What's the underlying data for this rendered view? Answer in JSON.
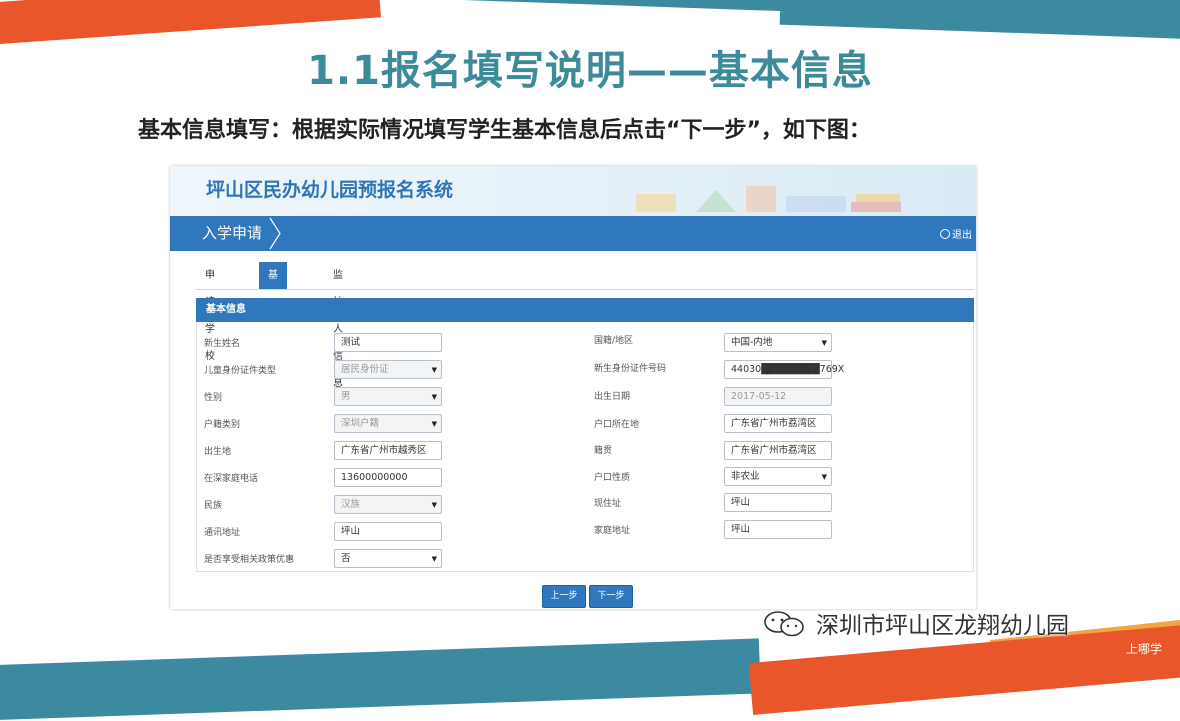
{
  "slide": {
    "title": "1.1报名填写说明——基本信息",
    "subtitle": "基本信息填写：根据实际情况填写学生基本信息后点击“下一步”，如下图："
  },
  "app": {
    "system_title": "坪山区民办幼儿园预报名系统",
    "nav_tab": "入学申请",
    "logout_label": "退出",
    "tabs": [
      {
        "label": "申请学校",
        "active": false
      },
      {
        "label": "基本信息",
        "active": true
      },
      {
        "label": "监护人信息",
        "active": false
      }
    ],
    "section_title": "基本信息",
    "left_fields": [
      {
        "label": "新生姓名",
        "value": "测试",
        "type": "input",
        "disabled": false
      },
      {
        "label": "儿童身份证件类型",
        "value": "居民身份证",
        "type": "select",
        "disabled": true
      },
      {
        "label": "性别",
        "value": "男",
        "type": "select",
        "disabled": true
      },
      {
        "label": "户籍类别",
        "value": "深圳户籍",
        "type": "select",
        "disabled": true
      },
      {
        "label": "出生地",
        "value": "广东省广州市越秀区",
        "type": "input",
        "disabled": false
      },
      {
        "label": "在深家庭电话",
        "value": "13600000000",
        "type": "input",
        "disabled": false
      },
      {
        "label": "民族",
        "value": "汉族",
        "type": "select",
        "disabled": true
      },
      {
        "label": "通讯地址",
        "value": "坪山",
        "type": "input",
        "disabled": false
      },
      {
        "label": "是否享受相关政策优惠",
        "value": "否",
        "type": "select",
        "disabled": false
      }
    ],
    "right_fields": [
      {
        "label": "国籍/地区",
        "value": "中国-内地",
        "type": "select",
        "disabled": false
      },
      {
        "label": "新生身份证件号码",
        "value": "44030████████769X",
        "type": "input",
        "disabled": false
      },
      {
        "label": "出生日期",
        "value": "2017-05-12",
        "type": "input",
        "disabled": true
      },
      {
        "label": "户口所在地",
        "value": "广东省广州市荔湾区",
        "type": "input",
        "disabled": false
      },
      {
        "label": "籍贯",
        "value": "广东省广州市荔湾区",
        "type": "input",
        "disabled": false
      },
      {
        "label": "户口性质",
        "value": "非农业",
        "type": "select",
        "disabled": false
      },
      {
        "label": "现住址",
        "value": "坪山",
        "type": "input",
        "disabled": false
      },
      {
        "label": "家庭地址",
        "value": "坪山",
        "type": "input",
        "disabled": false
      }
    ],
    "buttons": {
      "prev": "上一步",
      "next": "下一步"
    }
  },
  "watermark": "深圳市坪山区龙翔幼儿园",
  "corner_tag": "上哪学",
  "colors": {
    "accent_blue": "#2f78bd",
    "title_teal": "#3d8b98",
    "stripe_orange": "#e8562a",
    "stripe_teal": "#3c8aa0"
  },
  "icons": [
    "chevron-right-icon",
    "power-icon",
    "select-caret-icon",
    "wechat-icon"
  ]
}
